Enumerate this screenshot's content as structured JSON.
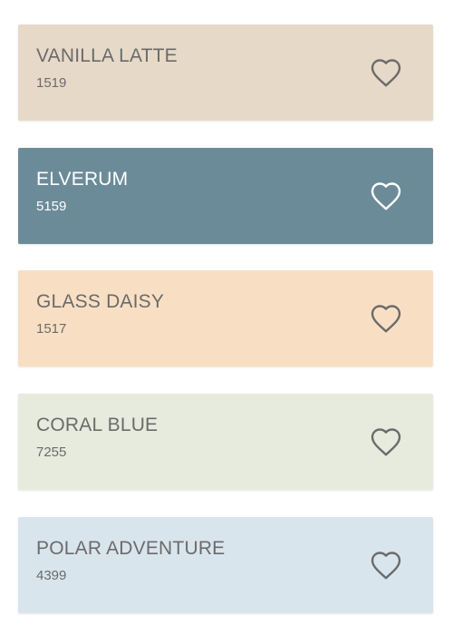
{
  "colors": [
    {
      "name": "VANILLA LATTE",
      "code": "1519",
      "swatch": "#e7d9c8",
      "text": "#6b6b6b",
      "icon": "heart-outline-icon"
    },
    {
      "name": "ELVERUM",
      "code": "5159",
      "swatch": "#6c8b99",
      "text": "#ffffff",
      "icon": "heart-outline-icon"
    },
    {
      "name": "GLASS DAISY",
      "code": "1517",
      "swatch": "#f8dfc4",
      "text": "#6b6b6b",
      "icon": "heart-outline-icon"
    },
    {
      "name": "CORAL BLUE",
      "code": "7255",
      "swatch": "#e7ebdd",
      "text": "#6b6b6b",
      "icon": "heart-outline-icon"
    },
    {
      "name": "POLAR ADVENTURE",
      "code": "4399",
      "swatch": "#d9e5ed",
      "text": "#6b6b6b",
      "icon": "heart-outline-icon"
    }
  ]
}
